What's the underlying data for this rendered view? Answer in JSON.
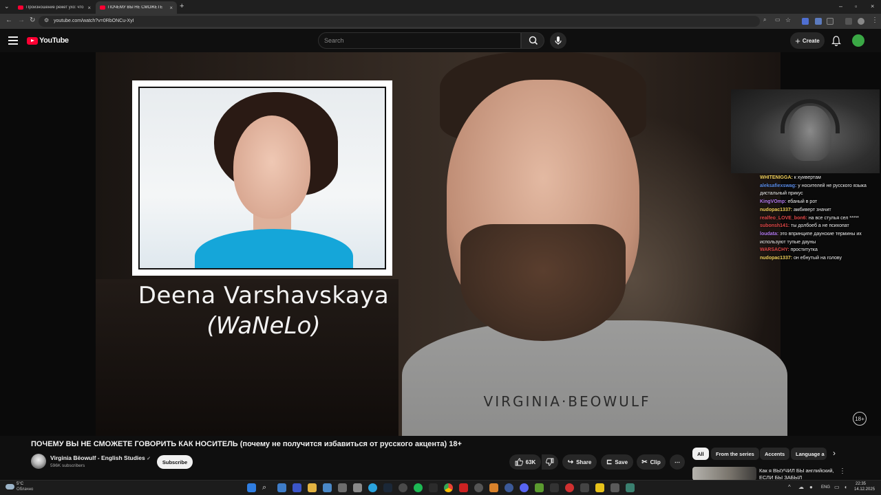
{
  "browser": {
    "tabs": [
      {
        "title": "Произношение режет ухо: что",
        "active": false
      },
      {
        "title": "ПОЧЕМУ ВЫ НЕ СМОЖЕТЕ",
        "active": true
      }
    ],
    "url": "youtube.com/watch?v=0RbONCu-XyI"
  },
  "masthead": {
    "logo_text": "YouTube",
    "search_placeholder": "Search",
    "create_label": "Create"
  },
  "video": {
    "caption_name": "Deena Varshavskaya",
    "caption_sub": "(WaNeLo)",
    "shirt_text": "VIRGINIA·BEOWULF",
    "rating_badge": "18+"
  },
  "stream_chat": [
    {
      "user": "WHITENIGGA:",
      "message": "к хуивертам",
      "color": "#f2d15c"
    },
    {
      "user": "aleksafiexswag:",
      "message": "у носителей не русского языка дистальный прикус",
      "color": "#5b8de8"
    },
    {
      "user": "KingVOmp:",
      "message": "ебаный в рот",
      "color": "#b57af0"
    },
    {
      "user": "nudopac1337:",
      "message": "амбиверт значит",
      "color": "#f2d15c"
    },
    {
      "user": "realfeo_LOVE_bon6:",
      "message": "на все стулья сел *****",
      "color": "#e04848"
    },
    {
      "user": "subonsh141:",
      "message": "ты долбоеб а не психопат",
      "color": "#e04848"
    },
    {
      "user": "loudata:",
      "message": "это впринципе даунские термины их используют тупые дауны",
      "color": "#b57af0"
    },
    {
      "user": "WARSACHY:",
      "message": "проститутка",
      "color": "#e04848"
    },
    {
      "user": "nudopac1337:",
      "message": "он ебнутый на голову",
      "color": "#f2d15c"
    }
  ],
  "info": {
    "title": "ПОЧЕМУ ВЫ НЕ СМОЖЕТЕ ГОВОРИТЬ КАК НОСИТЕЛЬ (почему не получится избавиться от русского акцента) 18+",
    "channel_name": "Virginia Bëowulf - English Studies",
    "subscribers": "596K subscribers",
    "subscribe_label": "Subscribe",
    "likes": "63K",
    "share_label": "Share",
    "save_label": "Save",
    "clip_label": "Clip"
  },
  "chips": [
    "All",
    "From the series",
    "Accents",
    "Language a"
  ],
  "recommendation": {
    "title": "Как я ВЫУЧИЛ БЫ английский, ЕСЛИ БЫ ЗАБЫЛ"
  },
  "taskbar": {
    "weather_temp": "5°C",
    "weather_desc": "Облачно",
    "lang": "ENG",
    "time": "22:35",
    "date": "14.12.2025"
  },
  "colors": {
    "youtube_red": "#ff0033",
    "background": "#0f0f0f",
    "chip_bg": "#272727"
  }
}
